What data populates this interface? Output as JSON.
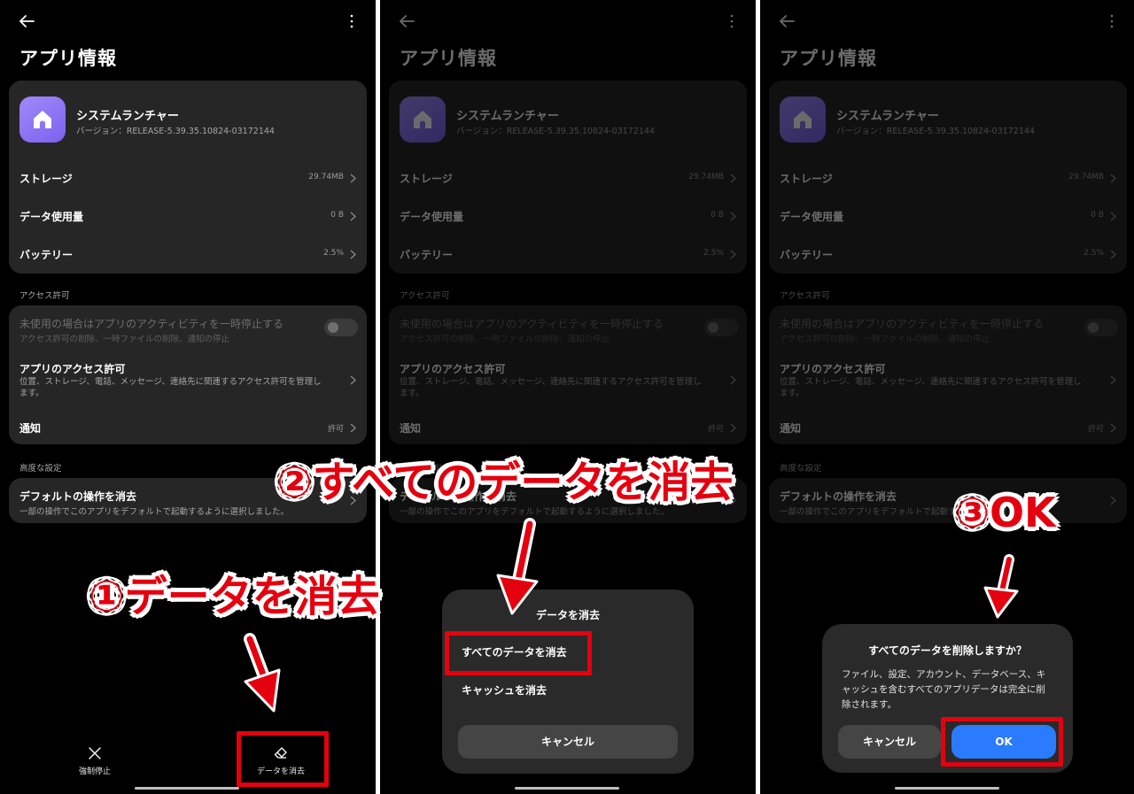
{
  "screens": [
    {
      "title": "アプリ情報",
      "app": {
        "name": "システムランチャー",
        "version": "バージョン：RELEASE-5.39.35.10824-03172144"
      },
      "rows": [
        {
          "label": "ストレージ",
          "value": "29.74MB"
        },
        {
          "label": "データ使用量",
          "value": "0 B"
        },
        {
          "label": "バッテリー",
          "value": "2.5%"
        }
      ],
      "access_section": "アクセス許可",
      "pause": {
        "title": "未使用の場合はアプリのアクティビティを一時停止する",
        "sub": "アクセス許可の削除、一時ファイルの削除、通知の停止"
      },
      "app_perm": {
        "title": "アプリのアクセス許可",
        "sub": "位置、ストレージ、電話、メッセージ、連絡先に関連するアクセス許可を管理します。"
      },
      "notify": {
        "label": "通知",
        "value": "許可"
      },
      "advanced_section": "高度な設定",
      "defaults": {
        "title": "デフォルトの操作を消去",
        "sub": "一部の操作でこのアプリをデフォルトで起動するように選択しました。"
      }
    }
  ],
  "bottom_bar": {
    "force_stop": "強制停止",
    "clear_data": "データを消去"
  },
  "sheet": {
    "title": "データを消去",
    "clear_all": "すべてのデータを消去",
    "clear_cache": "キャッシュを消去",
    "cancel": "キャンセル"
  },
  "dialog": {
    "title": "すべてのデータを削除しますか？",
    "message": "ファイル、設定、アカウント、データベース、キャッシュを含むすべてのアプリデータは完全に削除されます。",
    "cancel": "キャンセル",
    "ok": "OK"
  },
  "annotations": {
    "step1": "①データを消去",
    "step2": "②すべてのデータを消去",
    "step3": "③OK"
  },
  "colors": {
    "annotation": "#e5000f",
    "ok_button": "#2b7bff",
    "app_icon": "#8c78f5"
  }
}
